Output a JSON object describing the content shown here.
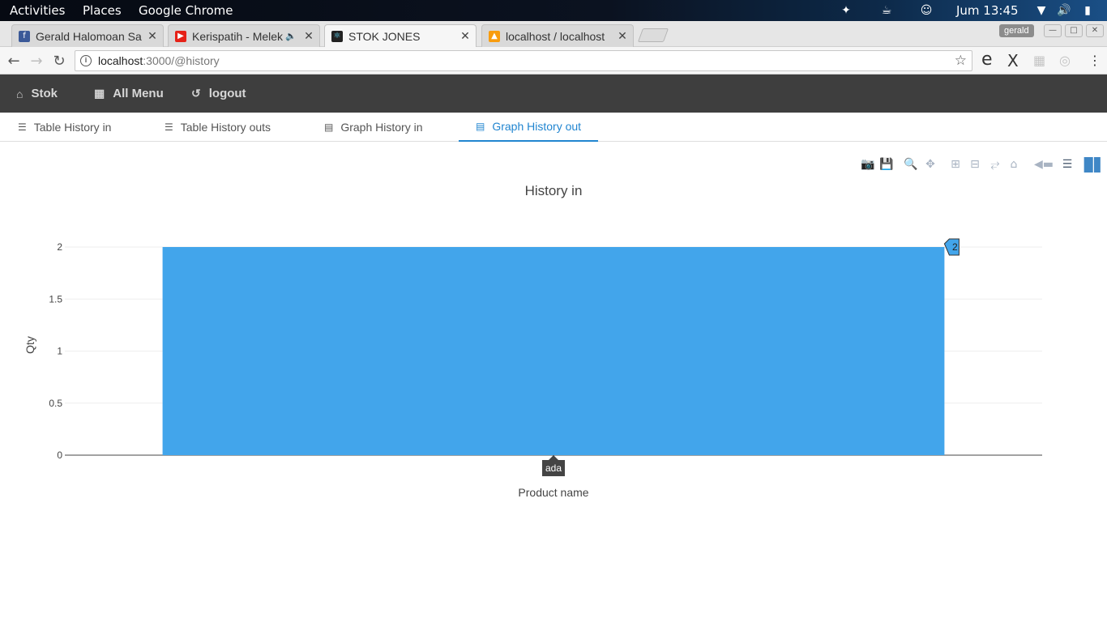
{
  "system_bar": {
    "activities": "Activities",
    "places": "Places",
    "app_name": "Google Chrome",
    "clock": "Jum 13:45"
  },
  "browser": {
    "tabs": [
      {
        "title": "Gerald Halomoan Sa",
        "favicon_color": "#3b5998",
        "active": false
      },
      {
        "title": "Kerispatih - Melek",
        "favicon_color": "#e62117",
        "active": false,
        "audio": true
      },
      {
        "title": "STOK JONES",
        "favicon_color": "#222222",
        "active": true
      },
      {
        "title": "localhost / localhost",
        "favicon_color": "#f89c0e",
        "active": false
      }
    ],
    "profile": "gerald",
    "url_host": "localhost",
    "url_path": ":3000/@history"
  },
  "navbar": {
    "items": [
      {
        "label": "Stok",
        "icon": "home-icon"
      },
      {
        "label": "All Menu",
        "icon": "grid-icon"
      },
      {
        "label": "logout",
        "icon": "logout-icon"
      }
    ]
  },
  "subtabs": {
    "items": [
      {
        "label": "Table History in",
        "icon": "list-icon",
        "active": false
      },
      {
        "label": "Table History outs",
        "icon": "list-icon",
        "active": false
      },
      {
        "label": "Graph History in",
        "icon": "chart-icon",
        "active": false
      },
      {
        "label": "Graph History out",
        "icon": "chart-icon",
        "active": true
      }
    ]
  },
  "modebar": {
    "icons": [
      "camera-icon",
      "save-icon",
      "zoom-icon",
      "pan-icon",
      "zoom-in-icon",
      "zoom-out-icon",
      "autoscale-icon",
      "reset-icon",
      "hover-closest-icon",
      "hover-compare-icon",
      "plotly-logo-icon"
    ]
  },
  "chart_data": {
    "type": "bar",
    "title": "History in",
    "xlabel": "Product name",
    "ylabel": "Qty",
    "categories": [
      "ada"
    ],
    "values": [
      2
    ],
    "ylim": [
      0,
      2
    ],
    "yticks": [
      "0",
      "0.5",
      "1",
      "1.5",
      "2"
    ],
    "grid": true,
    "bar_color": "#42a5eb",
    "hover": {
      "x_label": "ada",
      "y_label": "2"
    }
  }
}
